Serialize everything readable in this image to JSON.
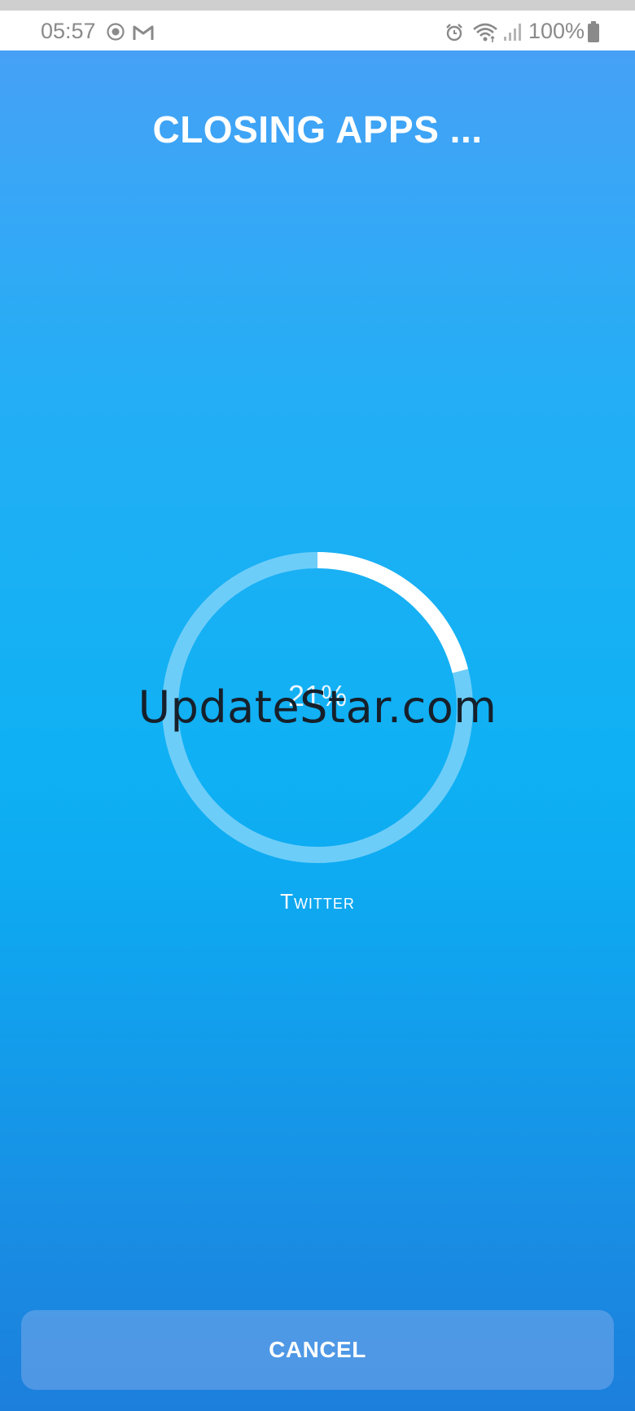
{
  "status_bar": {
    "time": "05:57",
    "battery_text": "100%",
    "icons": [
      "whatsapp-icon",
      "gmail-icon",
      "alarm-icon",
      "wifi-icon",
      "signal-icon",
      "battery-icon"
    ]
  },
  "screen": {
    "title": "CLOSING APPS ...",
    "progress_percent_text": "21%",
    "progress_fraction": 0.21,
    "current_app": "Twitter",
    "watermark": "UpdateStar.com",
    "cancel_label": "CANCEL"
  },
  "colors": {
    "ring_track": "#6dcdf9",
    "ring_progress": "#ffffff",
    "gradient_top": "#46a1f6",
    "gradient_bottom": "#1c7fdc"
  }
}
